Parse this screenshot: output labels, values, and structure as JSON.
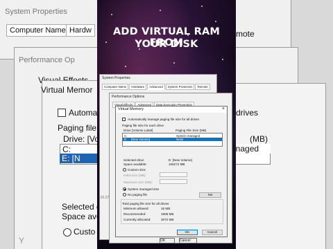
{
  "caption": {
    "line1": "ADD VIRTUAL RAM FROM",
    "line2": "YOUR DISK"
  },
  "zoom_left": {
    "sys_props_title": "System Properties",
    "tab_computer_name": "Computer Name",
    "tab_hardware": "Hardw",
    "perf_title": "Performance Op",
    "visual_effects": "Visual Effects",
    "vm_title": "Virtual Memor",
    "auto_manage": "Automa",
    "paging_file": "Paging file",
    "drive": "Drive: [Vo",
    "drive_c": "C:",
    "drive_e": "E:          [N",
    "selected": "Selected d",
    "space": "Space ave",
    "custom": "Custo",
    "extra": "Y"
  },
  "zoom_right": {
    "note": "mote",
    "drives": "drives",
    "mb": "(MB)",
    "managed": "managed"
  },
  "sys_props": {
    "title": "System Properties",
    "tabs": [
      "Computer Name",
      "Hardware",
      "Advanced",
      "System Protection",
      "Remote"
    ]
  },
  "perf_options": {
    "title": "Performance Options",
    "tabs": [
      "Visual Effects",
      "Advanced",
      "Data Execution Prevention"
    ]
  },
  "vm": {
    "title": "Virtual Memory",
    "auto_manage": "Automatically manage paging file size for all drives",
    "paging_header": "Paging file size for each drive",
    "col_drive": "Drive  [Volume Label]",
    "col_size": "Paging File Size (MB)",
    "drives": [
      {
        "drive": "C:",
        "label": "",
        "size": "System managed",
        "selected": false
      },
      {
        "drive": "E:",
        "label": "[New Volume]",
        "size": "None",
        "selected": true
      }
    ],
    "selected_drive_label": "Selected drive:",
    "selected_drive_value": "E:  [New Volume]",
    "space_label": "Space available:",
    "space_value": "106272 MB",
    "custom_size": "Custom size:",
    "initial_size": "Initial size (MB):",
    "maximum_size": "Maximum size (MB):",
    "system_managed": "System managed size",
    "no_paging": "No paging file",
    "set_button": "Set",
    "total_header": "Total paging file size for all drives",
    "min_label": "Minimum allowed:",
    "min_value": "16 MB",
    "rec_label": "Recommended:",
    "rec_value": "1908 MB",
    "cur_label": "Currently allocated:",
    "cur_value": "3072 MB",
    "ok": "OK",
    "cancel": "Cancel"
  },
  "behind": {
    "ok": "OK",
    "cancel": "Cancel",
    "small": "120.27"
  }
}
